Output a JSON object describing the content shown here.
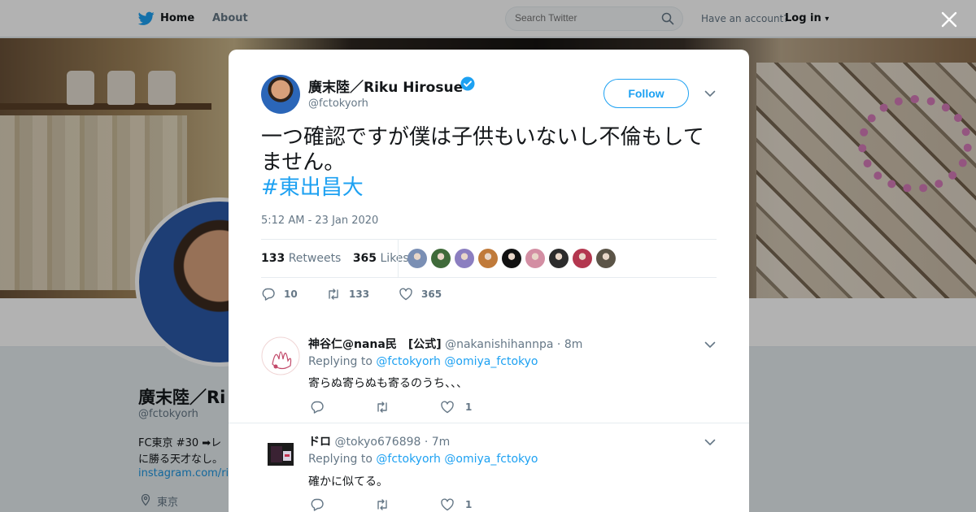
{
  "nav": {
    "home_label": "Home",
    "about_label": "About",
    "search_placeholder": "Search Twitter",
    "have_account": "Have an account?",
    "login_label": "Log in"
  },
  "profile": {
    "name": "廣末陸／Ri",
    "handle": "@fctokyorh",
    "bio_line1": "FC東京 #30 ➡レ",
    "bio_line2": "に勝る天才なし。",
    "link": "instagram.com/rik",
    "location": "東京"
  },
  "tweet": {
    "author_name": "廣末陸／Riku Hirosue",
    "author_handle": "@fctokyorh",
    "follow_label": "Follow",
    "text": "一つ確認ですが僕は子供もいないし不倫もしてません。",
    "hashtag": "#東出昌大",
    "timestamp": "5:12 AM - 23 Jan 2020",
    "retweets_count": "133",
    "retweets_label": "Retweets",
    "likes_count": "365",
    "likes_label": "Likes",
    "reply_action_count": "10",
    "retweet_action_count": "133",
    "like_action_count": "365",
    "liker_colors": [
      "#7a8fb4",
      "#3f6a3a",
      "#8b7ec0",
      "#c07a3a",
      "#111111",
      "#d38ea3",
      "#2c2c2c",
      "#b3374f",
      "#5b5447"
    ]
  },
  "replies": [
    {
      "name": "神谷仁@nana民　[公式]",
      "handle": "@nakanishihannpa",
      "time": "· 8m",
      "replying_to": "Replying to",
      "mention1": "@fctokyorh",
      "mention2": "@omiya_fctokyo",
      "text": "寄らぬ寄らぬも寄るのうち、、、",
      "like_count": "1"
    },
    {
      "name": "ドロ",
      "handle": "@tokyo676898",
      "time": "· 7m",
      "replying_to": "Replying to",
      "mention1": "@fctokyorh",
      "mention2": "@omiya_fctokyo",
      "text": "確かに似てる。",
      "like_count": "1"
    }
  ],
  "colors": {
    "accent": "#1da1f2",
    "text_secondary": "#657786",
    "background": "#e6ecf0"
  }
}
